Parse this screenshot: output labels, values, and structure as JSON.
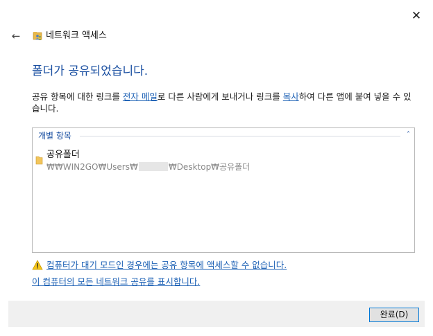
{
  "window": {
    "title": "네트워크 액세스",
    "close_glyph": "✕",
    "back_glyph": "←"
  },
  "main": {
    "heading": "폴더가 공유되었습니다.",
    "description": {
      "part1": "공유 항목에 대한 링크를 ",
      "email_link": "전자 메일",
      "part2": "로 다른 사람에게 보내거나 링크를 ",
      "copy_link": "복사",
      "part3": "하여 다른 앱에 붙여 넣을 수 있습니다."
    }
  },
  "shared_items": {
    "group_label": "개별 항목",
    "collapse_glyph": "˄",
    "items": [
      {
        "name": "공유폴더",
        "path_prefix": "₩₩WIN2GO₩Users₩",
        "path_suffix": "₩Desktop₩공유폴더"
      }
    ]
  },
  "links": {
    "warning": "컴퓨터가 대기 모드인 경우에는 공유 항목에 액세스할 수 없습니다.",
    "show_all": "이 컴퓨터의 모든 네트워크 공유를 표시합니다."
  },
  "footer": {
    "done_label": "완료(D)"
  },
  "colors": {
    "accent": "#1a4fa1",
    "link": "#1a5fb4",
    "button_border": "#0078d7",
    "footer_bg": "#f0f0f0"
  },
  "icons": {
    "title": "network-share-icon",
    "folder": "folder-icon",
    "warning": "warning-icon"
  }
}
